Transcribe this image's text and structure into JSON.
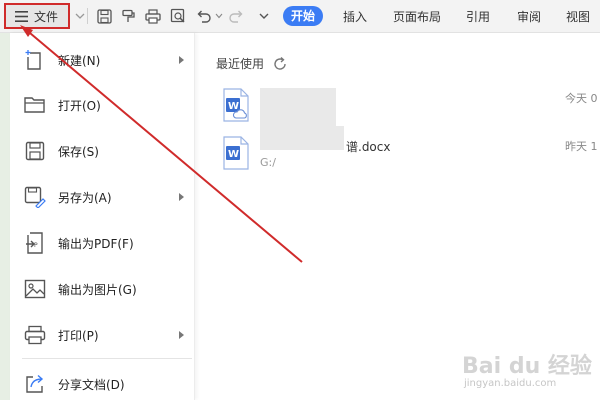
{
  "toolbar": {
    "file_label": "文件",
    "tabs": [
      {
        "label": "开始",
        "active": true
      },
      {
        "label": "插入",
        "active": false
      },
      {
        "label": "页面布局",
        "active": false
      },
      {
        "label": "引用",
        "active": false
      },
      {
        "label": "审阅",
        "active": false
      },
      {
        "label": "视图",
        "active": false
      }
    ],
    "icons": [
      "save-icon",
      "format-painter-icon",
      "print-icon",
      "print-preview-icon",
      "undo-icon",
      "redo-icon",
      "more-dropdown-icon"
    ]
  },
  "menu": {
    "items": [
      {
        "label": "新建(N)",
        "icon": "new-document-icon",
        "submenu": true
      },
      {
        "label": "打开(O)",
        "icon": "open-folder-icon",
        "submenu": false
      },
      {
        "label": "保存(S)",
        "icon": "save-icon",
        "submenu": false
      },
      {
        "label": "另存为(A)",
        "icon": "save-as-icon",
        "submenu": true
      },
      {
        "label": "输出为PDF(F)",
        "icon": "export-pdf-icon",
        "submenu": false
      },
      {
        "label": "输出为图片(G)",
        "icon": "export-image-icon",
        "submenu": false
      },
      {
        "label": "打印(P)",
        "icon": "print-icon",
        "submenu": true
      },
      {
        "label": "分享文档(D)",
        "icon": "share-icon",
        "submenu": false
      }
    ]
  },
  "recent": {
    "title": "最近使用",
    "files": [
      {
        "name": "",
        "path": "",
        "time": "今天 0"
      },
      {
        "name": "谱.docx",
        "path": "G:/",
        "time": "昨天 1"
      }
    ]
  },
  "colors": {
    "accent": "#3b7cf4",
    "annotation": "#d02b2b",
    "word_icon": "#3b6fd1"
  },
  "watermark": {
    "main": "Bai du 经验",
    "sub": "jingyan.baidu.com"
  }
}
